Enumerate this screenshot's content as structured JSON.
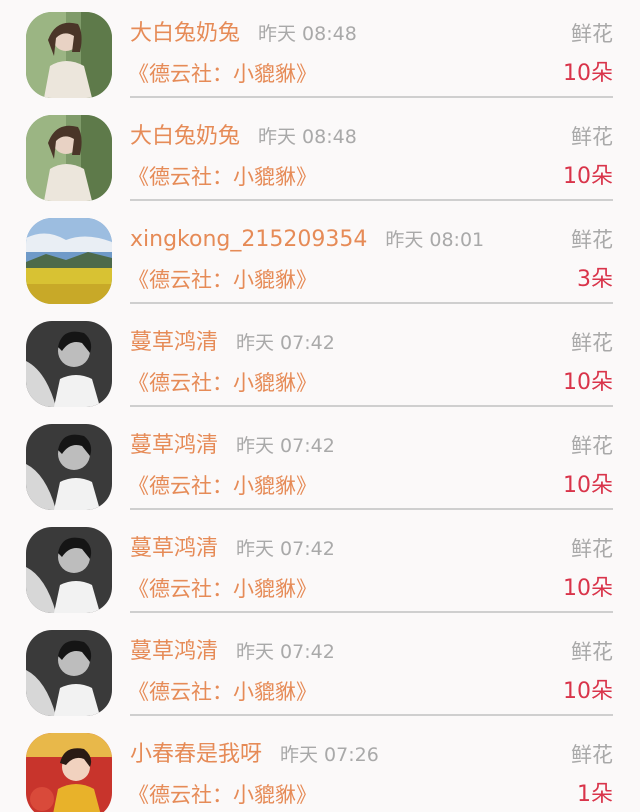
{
  "rows": [
    {
      "name": "大白兔奶兔",
      "time": "昨天 08:48",
      "gift": "鲜花",
      "show": "《德云社：小貔貅》",
      "count": "10朵",
      "avatar": "girl-photo"
    },
    {
      "name": "大白兔奶兔",
      "time": "昨天 08:48",
      "gift": "鲜花",
      "show": "《德云社：小貔貅》",
      "count": "10朵",
      "avatar": "girl-photo"
    },
    {
      "name": "xingkong_215209354",
      "time": "昨天 08:01",
      "gift": "鲜花",
      "show": "《德云社：小貔貅》",
      "count": "3朵",
      "avatar": "landscape-photo"
    },
    {
      "name": "蔓草鸿清",
      "time": "昨天 07:42",
      "gift": "鲜花",
      "show": "《德云社：小貔貅》",
      "count": "10朵",
      "avatar": "bw-portrait-photo"
    },
    {
      "name": "蔓草鸿清",
      "time": "昨天 07:42",
      "gift": "鲜花",
      "show": "《德云社：小貔貅》",
      "count": "10朵",
      "avatar": "bw-portrait-photo"
    },
    {
      "name": "蔓草鸿清",
      "time": "昨天 07:42",
      "gift": "鲜花",
      "show": "《德云社：小貔貅》",
      "count": "10朵",
      "avatar": "bw-portrait-photo"
    },
    {
      "name": "蔓草鸿清",
      "time": "昨天 07:42",
      "gift": "鲜花",
      "show": "《德云社：小貔貅》",
      "count": "10朵",
      "avatar": "bw-portrait-photo"
    },
    {
      "name": "小春春是我呀",
      "time": "昨天 07:26",
      "gift": "鲜花",
      "show": "《德云社：小貔貅》",
      "count": "1朵",
      "avatar": "red-costume-photo"
    }
  ],
  "colors": {
    "name": "#e68b57",
    "muted": "#a9a9a9",
    "count": "#d9344a",
    "background": "#fbf9f9"
  }
}
